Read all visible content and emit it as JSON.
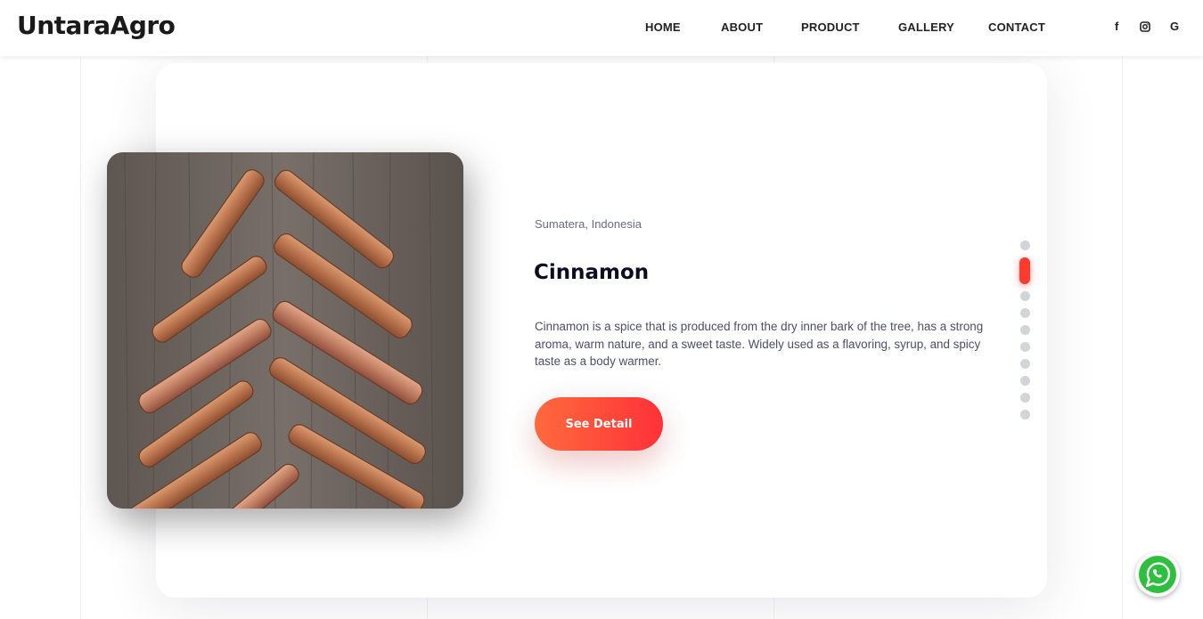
{
  "brand": {
    "logo": "UntaraAgro"
  },
  "nav": {
    "items": [
      "HOME",
      "ABOUT",
      "PRODUCT",
      "GALLERY",
      "CONTACT"
    ]
  },
  "social": [
    {
      "icon": "facebook-icon",
      "glyph": "f"
    },
    {
      "icon": "instagram-icon",
      "glyph": "◎"
    },
    {
      "icon": "google-icon",
      "glyph": "G"
    }
  ],
  "product": {
    "location": "Sumatera, Indonesia",
    "title": "Cinnamon",
    "description": "Cinnamon is a spice that is produced from the dry inner bark of the tree, has a strong aroma, warm nature, and a sweet taste. Widely used as a flavoring, syrup, and spicy taste as a body warmer.",
    "button_label": "See Detail",
    "image_alt": "cinnamon-sticks-photo"
  },
  "slider": {
    "total": 10,
    "active_index": 1
  },
  "colors": {
    "accent": "#ff3b30",
    "button_gradient_start": "#ff6a3d",
    "button_gradient_end": "#ff3138",
    "whatsapp": "#2fbf3f"
  }
}
